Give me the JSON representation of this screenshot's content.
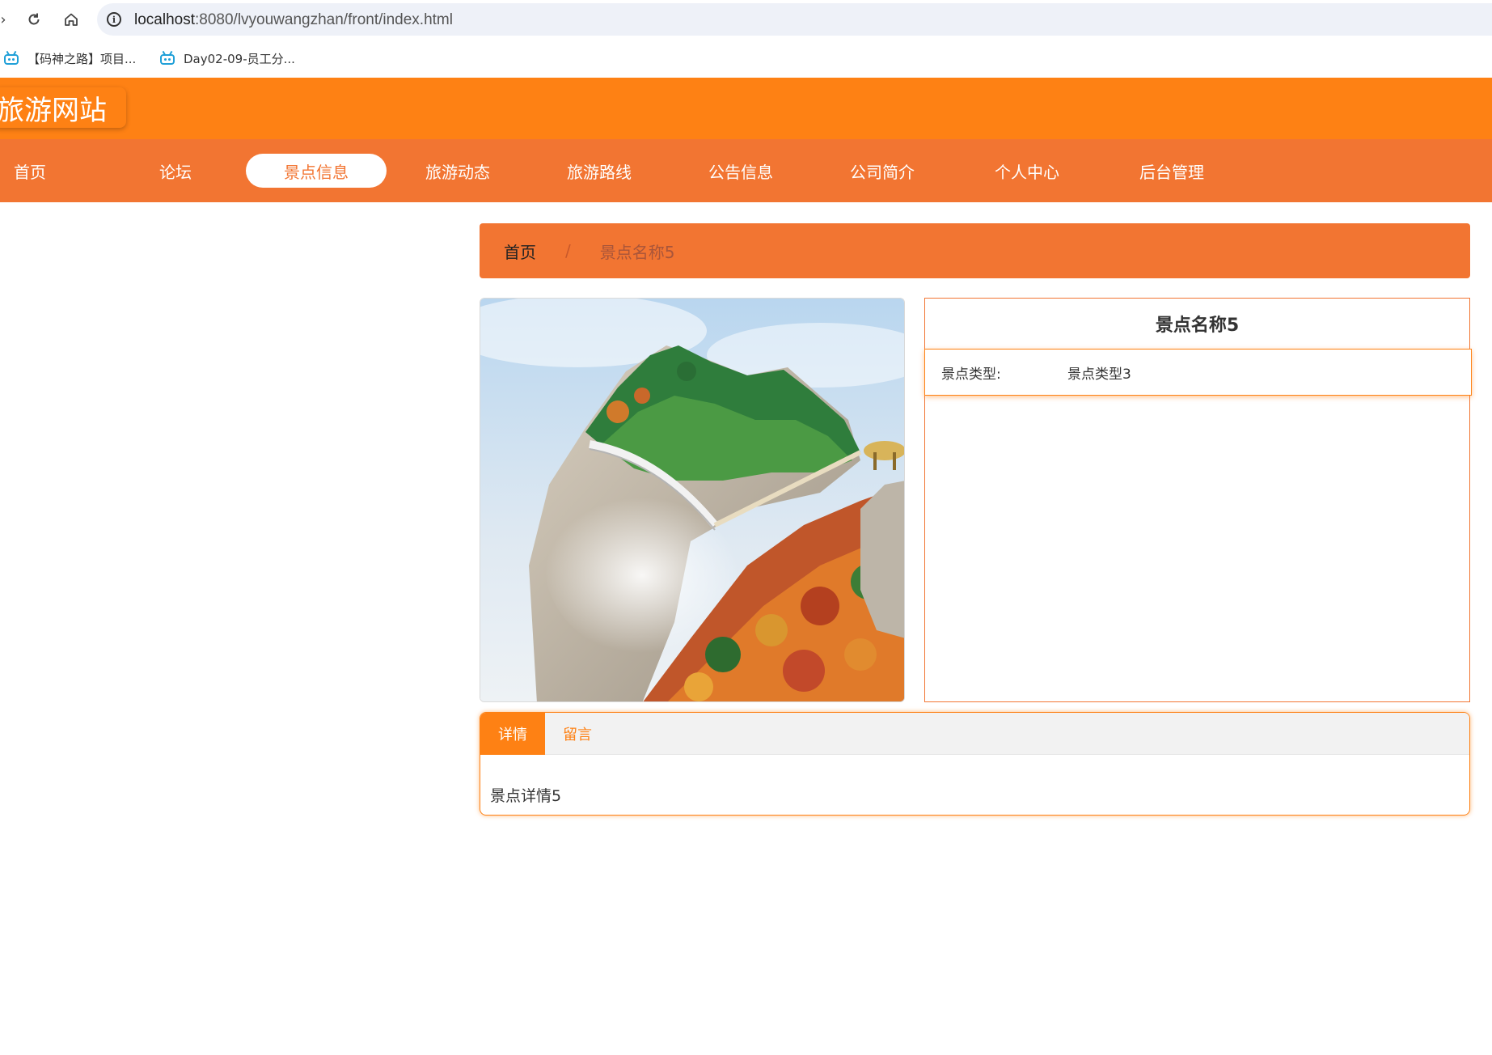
{
  "browser": {
    "url_host": "localhost",
    "url_path": ":8080/lvyouwangzhan/front/index.html",
    "bookmarks": [
      {
        "label": "【码神之路】项目..."
      },
      {
        "label": "Day02-09-员工分..."
      }
    ]
  },
  "site": {
    "logo": "旅游网站"
  },
  "nav": {
    "items": [
      {
        "label": "首页"
      },
      {
        "label": "论坛"
      },
      {
        "label": "景点信息"
      },
      {
        "label": "旅游动态"
      },
      {
        "label": "旅游路线"
      },
      {
        "label": "公告信息"
      },
      {
        "label": "公司简介"
      },
      {
        "label": "个人中心"
      },
      {
        "label": "后台管理"
      }
    ],
    "active_index": 2
  },
  "breadcrumb": {
    "home": "首页",
    "separator": "/",
    "current": "景点名称5"
  },
  "detail": {
    "title": "景点名称5",
    "type_label": "景点类型:",
    "type_value": "景点类型3"
  },
  "tabs": {
    "items": [
      {
        "label": "详情"
      },
      {
        "label": "留言"
      }
    ],
    "active_index": 0,
    "content": "景点详情5"
  },
  "colors": {
    "header": "#fe8114",
    "nav": "#f27532"
  }
}
